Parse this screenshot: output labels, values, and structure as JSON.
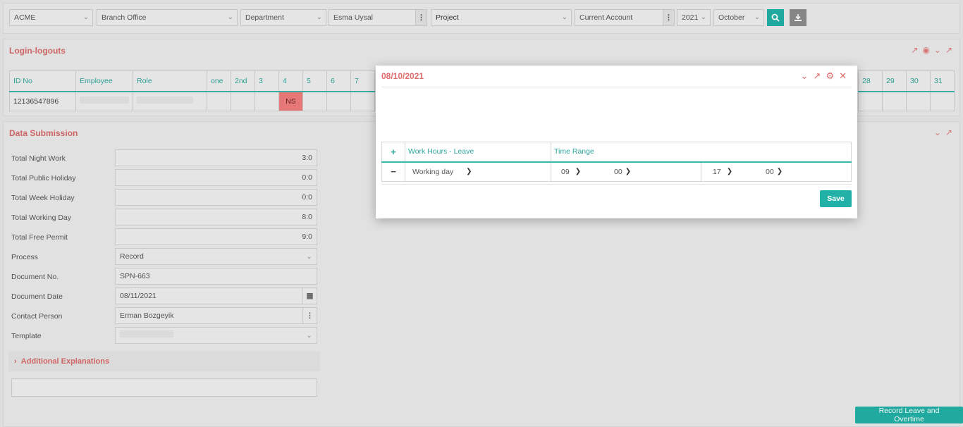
{
  "filters": {
    "company": "ACME",
    "branch": "Branch Office",
    "department": "Department",
    "employee": "Esma Uysal",
    "project": "Project",
    "account": "Current Account",
    "year": "2021",
    "month": "October"
  },
  "login_section": {
    "title": "Login-logouts",
    "headers": [
      "ID No",
      "Employee",
      "Role",
      "one",
      "2nd",
      "3",
      "4",
      "5",
      "6",
      "7"
    ],
    "headers_tail": [
      "28",
      "29",
      "30",
      "31"
    ],
    "row": {
      "id": "12136547896",
      "ns": "NS"
    }
  },
  "data_section": {
    "title": "Data Submission",
    "fields": [
      {
        "label": "Total Night Work",
        "value": "3:0"
      },
      {
        "label": "Total Public Holiday",
        "value": "0:0"
      },
      {
        "label": "Total Week Holiday",
        "value": "0:0"
      },
      {
        "label": "Total Working Day",
        "value": "8:0"
      },
      {
        "label": "Total Free Permit",
        "value": "9:0"
      }
    ],
    "process": {
      "label": "Process",
      "value": "Record"
    },
    "document_no": {
      "label": "Document No.",
      "value": "SPN-663"
    },
    "document_date": {
      "label": "Document Date",
      "value": "08/11/2021"
    },
    "contact": {
      "label": "Contact Person",
      "value": "Erman Bozgeyik"
    },
    "template": {
      "label": "Template"
    },
    "additional": "Additional Explanations",
    "record_button": "Record Leave and Overtime"
  },
  "modal": {
    "title": "08/10/2021",
    "col_work": "Work Hours - Leave",
    "col_range": "Time Range",
    "row": {
      "type": "Working day",
      "start_h": "09",
      "start_m": "00",
      "end_h": "17",
      "end_m": "00"
    },
    "save": "Save"
  },
  "colors": {
    "accent": "#22b1a6",
    "title": "#d76a6a",
    "ns": "#f07d7d"
  }
}
